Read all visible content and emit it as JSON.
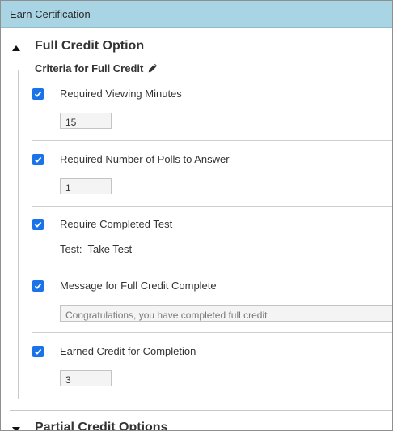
{
  "window": {
    "title": "Earn Certification"
  },
  "full_credit": {
    "title": "Full Credit Option",
    "criteria_legend": "Criteria for Full Credit",
    "items": [
      {
        "label": "Required Viewing Minutes",
        "checked": true,
        "value": "15"
      },
      {
        "label": "Required Number of Polls to Answer",
        "checked": true,
        "value": "1"
      },
      {
        "label": "Require Completed Test",
        "checked": true,
        "test_label": "Test:",
        "test_value": "Take Test"
      },
      {
        "label": "Message for Full Credit Complete",
        "checked": true,
        "value": "Congratulations, you have completed full credit"
      },
      {
        "label": "Earned Credit for Completion",
        "checked": true,
        "value": "3"
      }
    ]
  },
  "partial_credit": {
    "title": "Partial Credit Options"
  },
  "colors": {
    "titlebar": "#a8d4e4",
    "checkbox": "#1a73e8"
  }
}
